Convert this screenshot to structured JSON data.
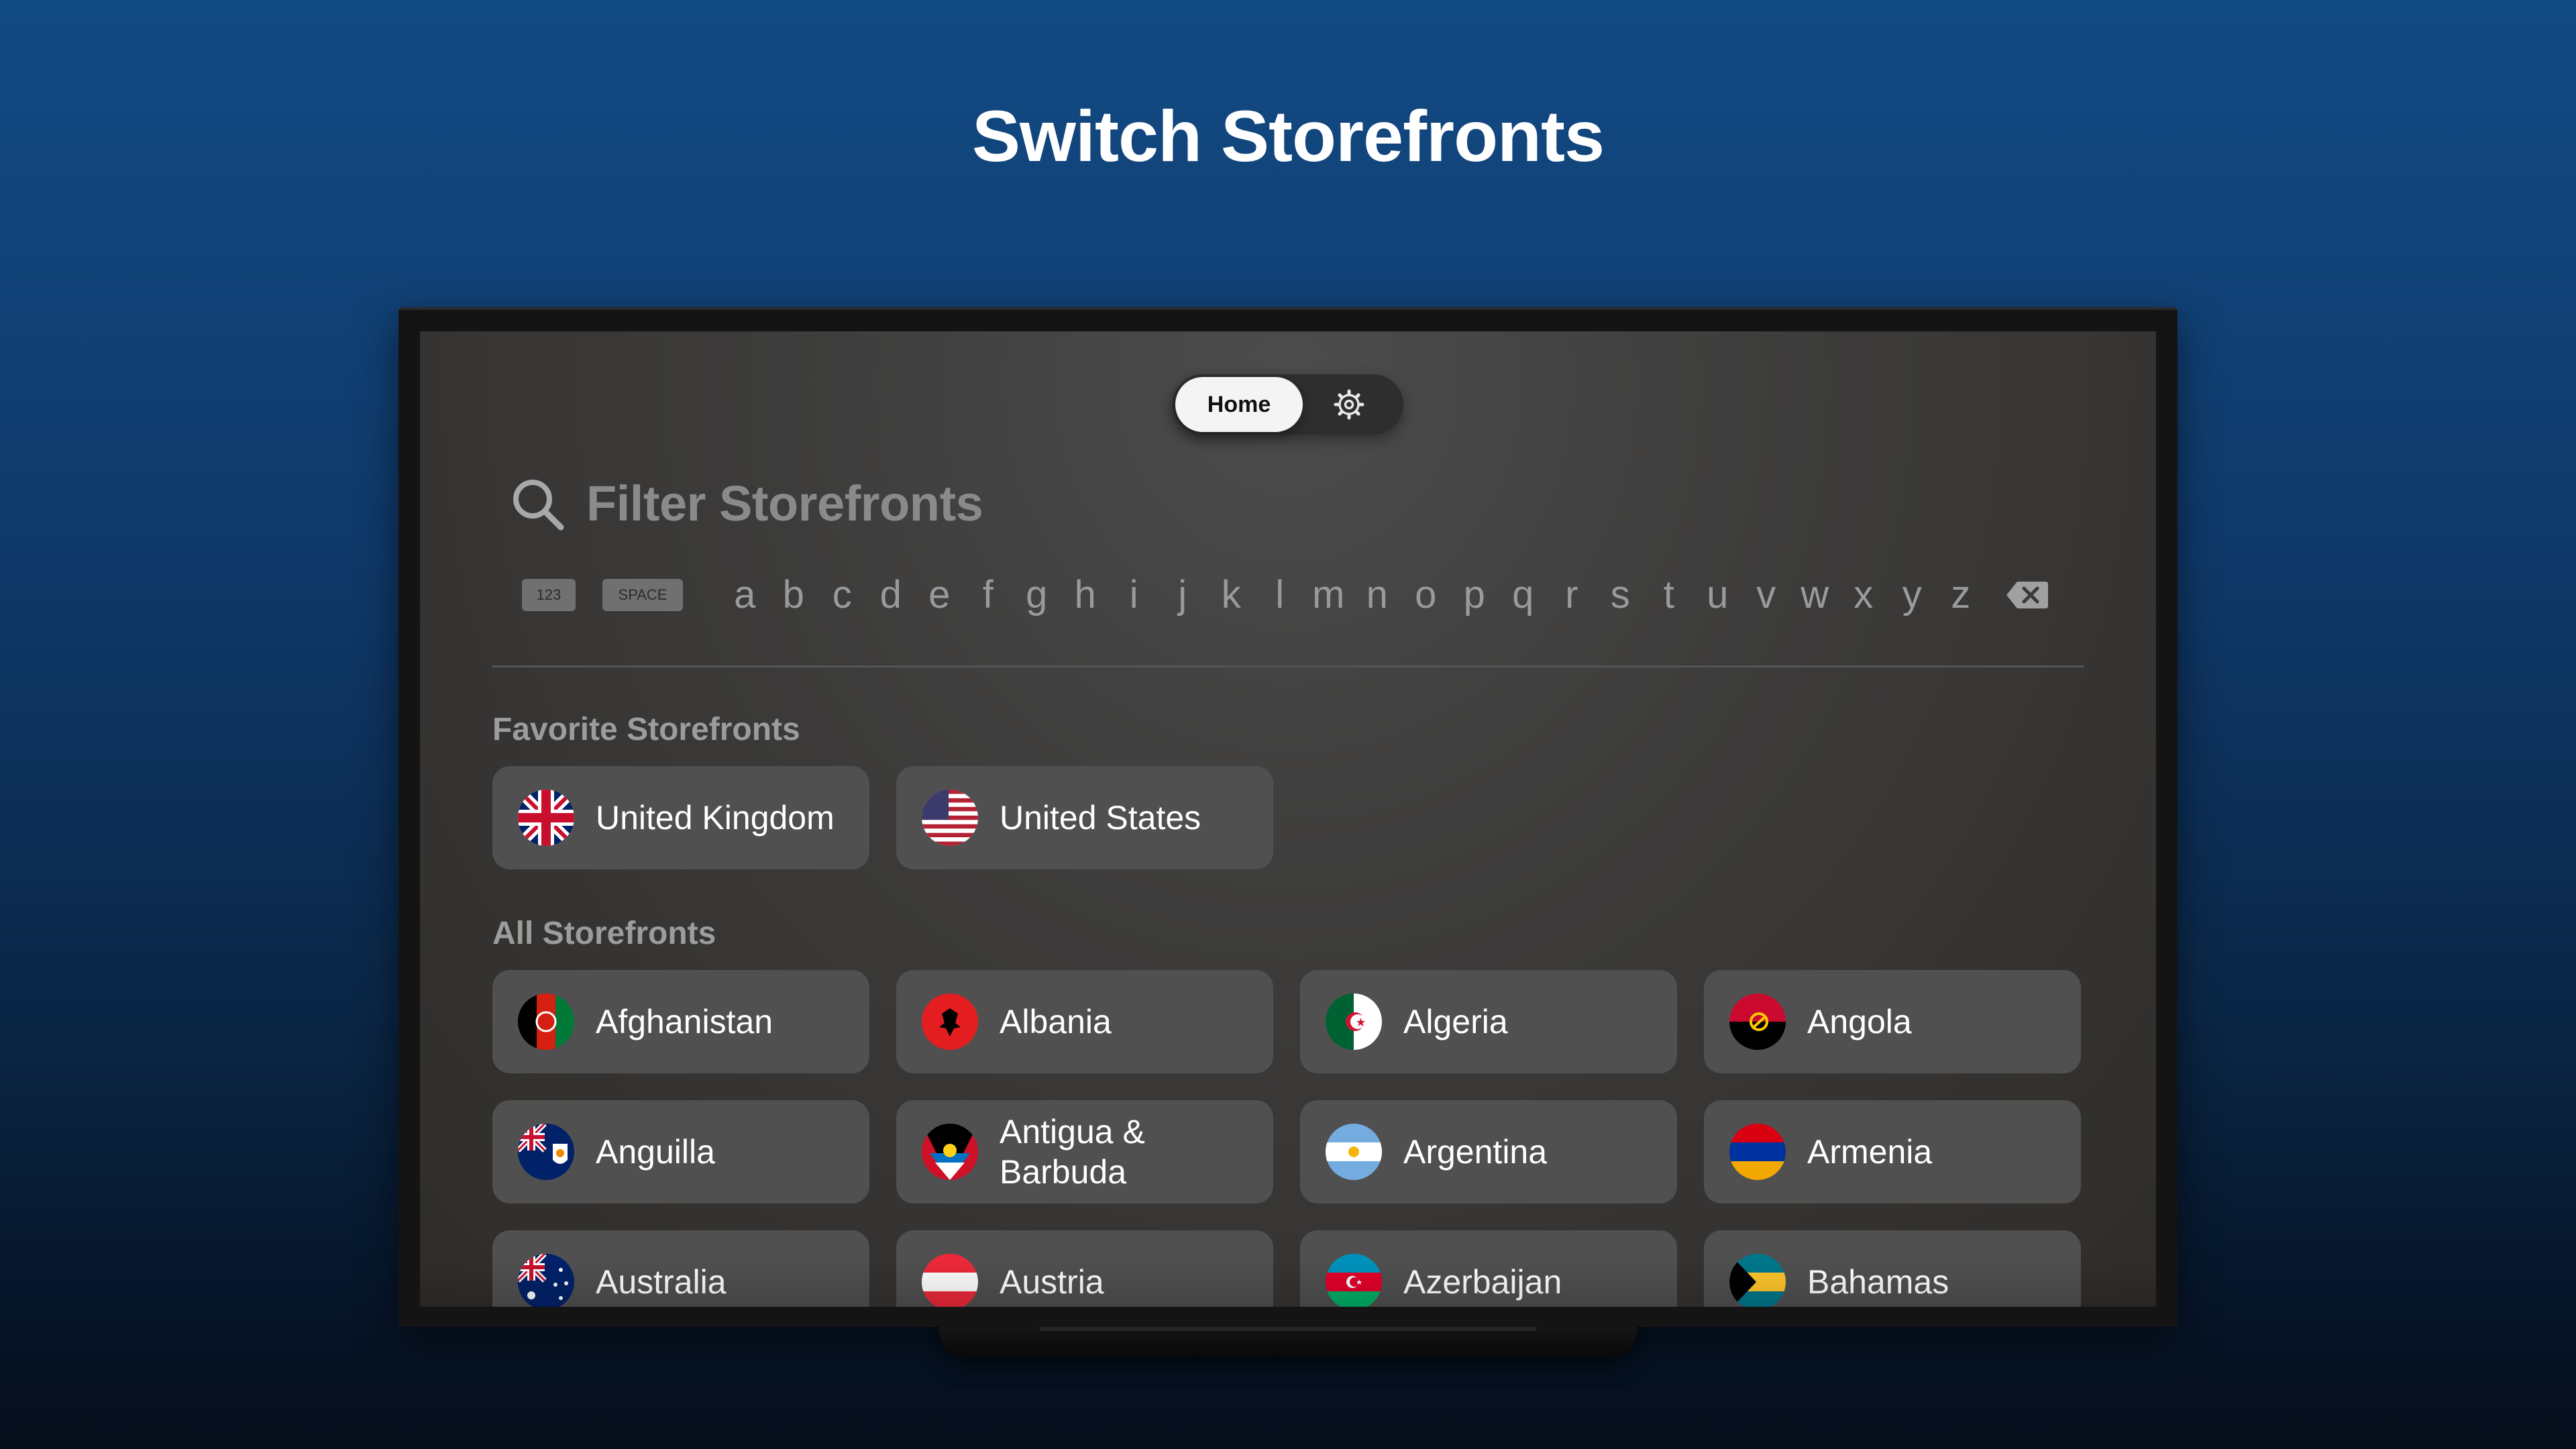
{
  "headline": "Switch Storefronts",
  "nav": {
    "home_label": "Home",
    "settings_icon": "gear-icon"
  },
  "search": {
    "placeholder": "Filter Storefronts",
    "icon": "search-icon"
  },
  "keyboard": {
    "numbers_key": "123",
    "space_key": "SPACE",
    "letters": [
      "a",
      "b",
      "c",
      "d",
      "e",
      "f",
      "g",
      "h",
      "i",
      "j",
      "k",
      "l",
      "m",
      "n",
      "o",
      "p",
      "q",
      "r",
      "s",
      "t",
      "u",
      "v",
      "w",
      "x",
      "y",
      "z"
    ],
    "delete_icon": "backspace-icon"
  },
  "favorites": {
    "title": "Favorite Storefronts",
    "items": [
      {
        "label": "United Kingdom",
        "flag": "gb"
      },
      {
        "label": "United States",
        "flag": "us"
      }
    ]
  },
  "all": {
    "title": "All Storefronts",
    "items": [
      {
        "label": "Afghanistan",
        "flag": "af"
      },
      {
        "label": "Albania",
        "flag": "al"
      },
      {
        "label": "Algeria",
        "flag": "dz"
      },
      {
        "label": "Angola",
        "flag": "ao"
      },
      {
        "label": "Anguilla",
        "flag": "ai"
      },
      {
        "label": "Antigua & Barbuda",
        "flag": "ag"
      },
      {
        "label": "Argentina",
        "flag": "ar"
      },
      {
        "label": "Armenia",
        "flag": "am"
      },
      {
        "label": "Australia",
        "flag": "au"
      },
      {
        "label": "Austria",
        "flag": "at"
      },
      {
        "label": "Azerbaijan",
        "flag": "az"
      },
      {
        "label": "Bahamas",
        "flag": "bs"
      }
    ]
  }
}
